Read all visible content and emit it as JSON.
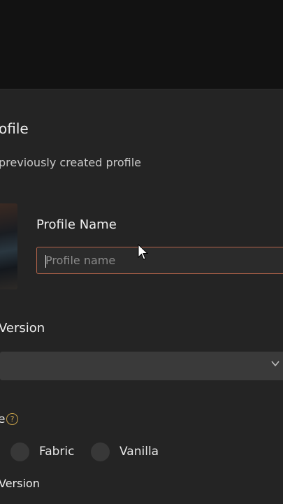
{
  "dialog": {
    "title": "ofile",
    "subtitle": "previously created profile",
    "profile_name": {
      "label": "Profile Name",
      "placeholder": "Profile name",
      "value": ""
    },
    "game_version": {
      "label": "Version",
      "selected": ""
    },
    "loader": {
      "label_tail": "e",
      "help_icon": "question-circle-icon",
      "options": [
        "Fabric",
        "Vanilla"
      ]
    },
    "loader_version": {
      "label": "Version"
    }
  },
  "colors": {
    "dialog_bg": "#242424",
    "input_border_focus": "#b4644a",
    "help_icon": "#c8a24a"
  }
}
